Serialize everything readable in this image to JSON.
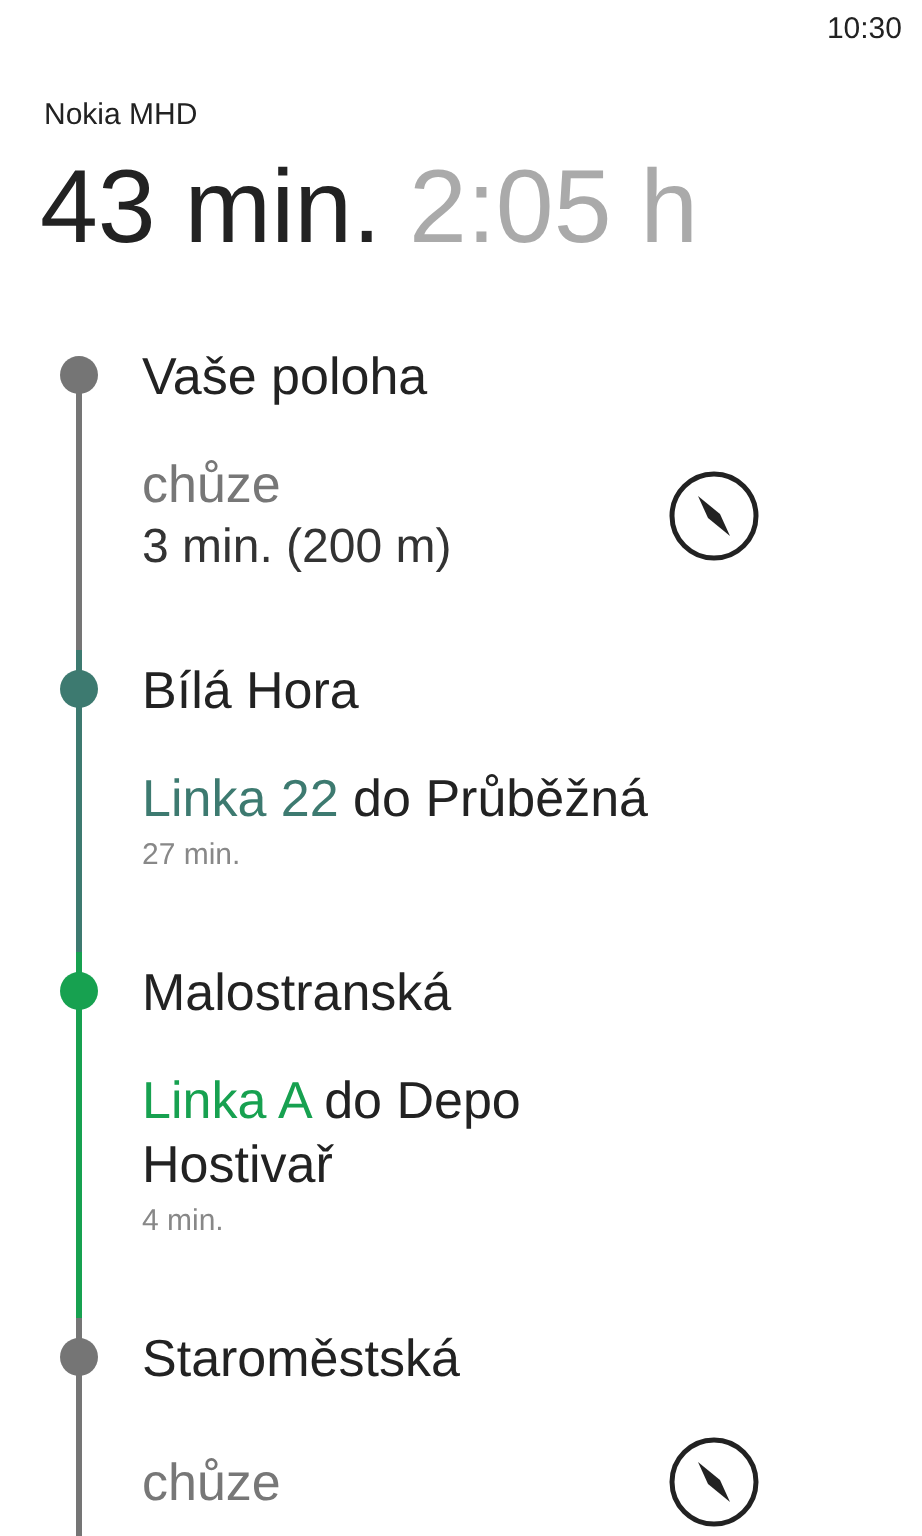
{
  "status_bar": {
    "time": "10:30"
  },
  "app_title": "Nokia MHD",
  "summary": {
    "duration": "43 min.",
    "arrival": "2:05 h"
  },
  "route": [
    {
      "stop": "Vaše poloha",
      "color": "#757575",
      "leg": {
        "kind": "walk",
        "mode": "chůze",
        "detail": "3 min. (200 m)"
      }
    },
    {
      "stop": "Bílá Hora",
      "color": "#3d7a70",
      "leg": {
        "kind": "transit",
        "line": "Linka 22",
        "direction": "do Průběžná",
        "duration": "27 min."
      }
    },
    {
      "stop": "Malostranská",
      "color": "#17a150",
      "leg": {
        "kind": "transit",
        "line": "Linka A",
        "direction": "do Depo Hostivař",
        "duration": "4 min."
      }
    },
    {
      "stop": "Staroměstská",
      "color": "#757575",
      "leg": {
        "kind": "walk",
        "mode": "chůze"
      }
    }
  ]
}
